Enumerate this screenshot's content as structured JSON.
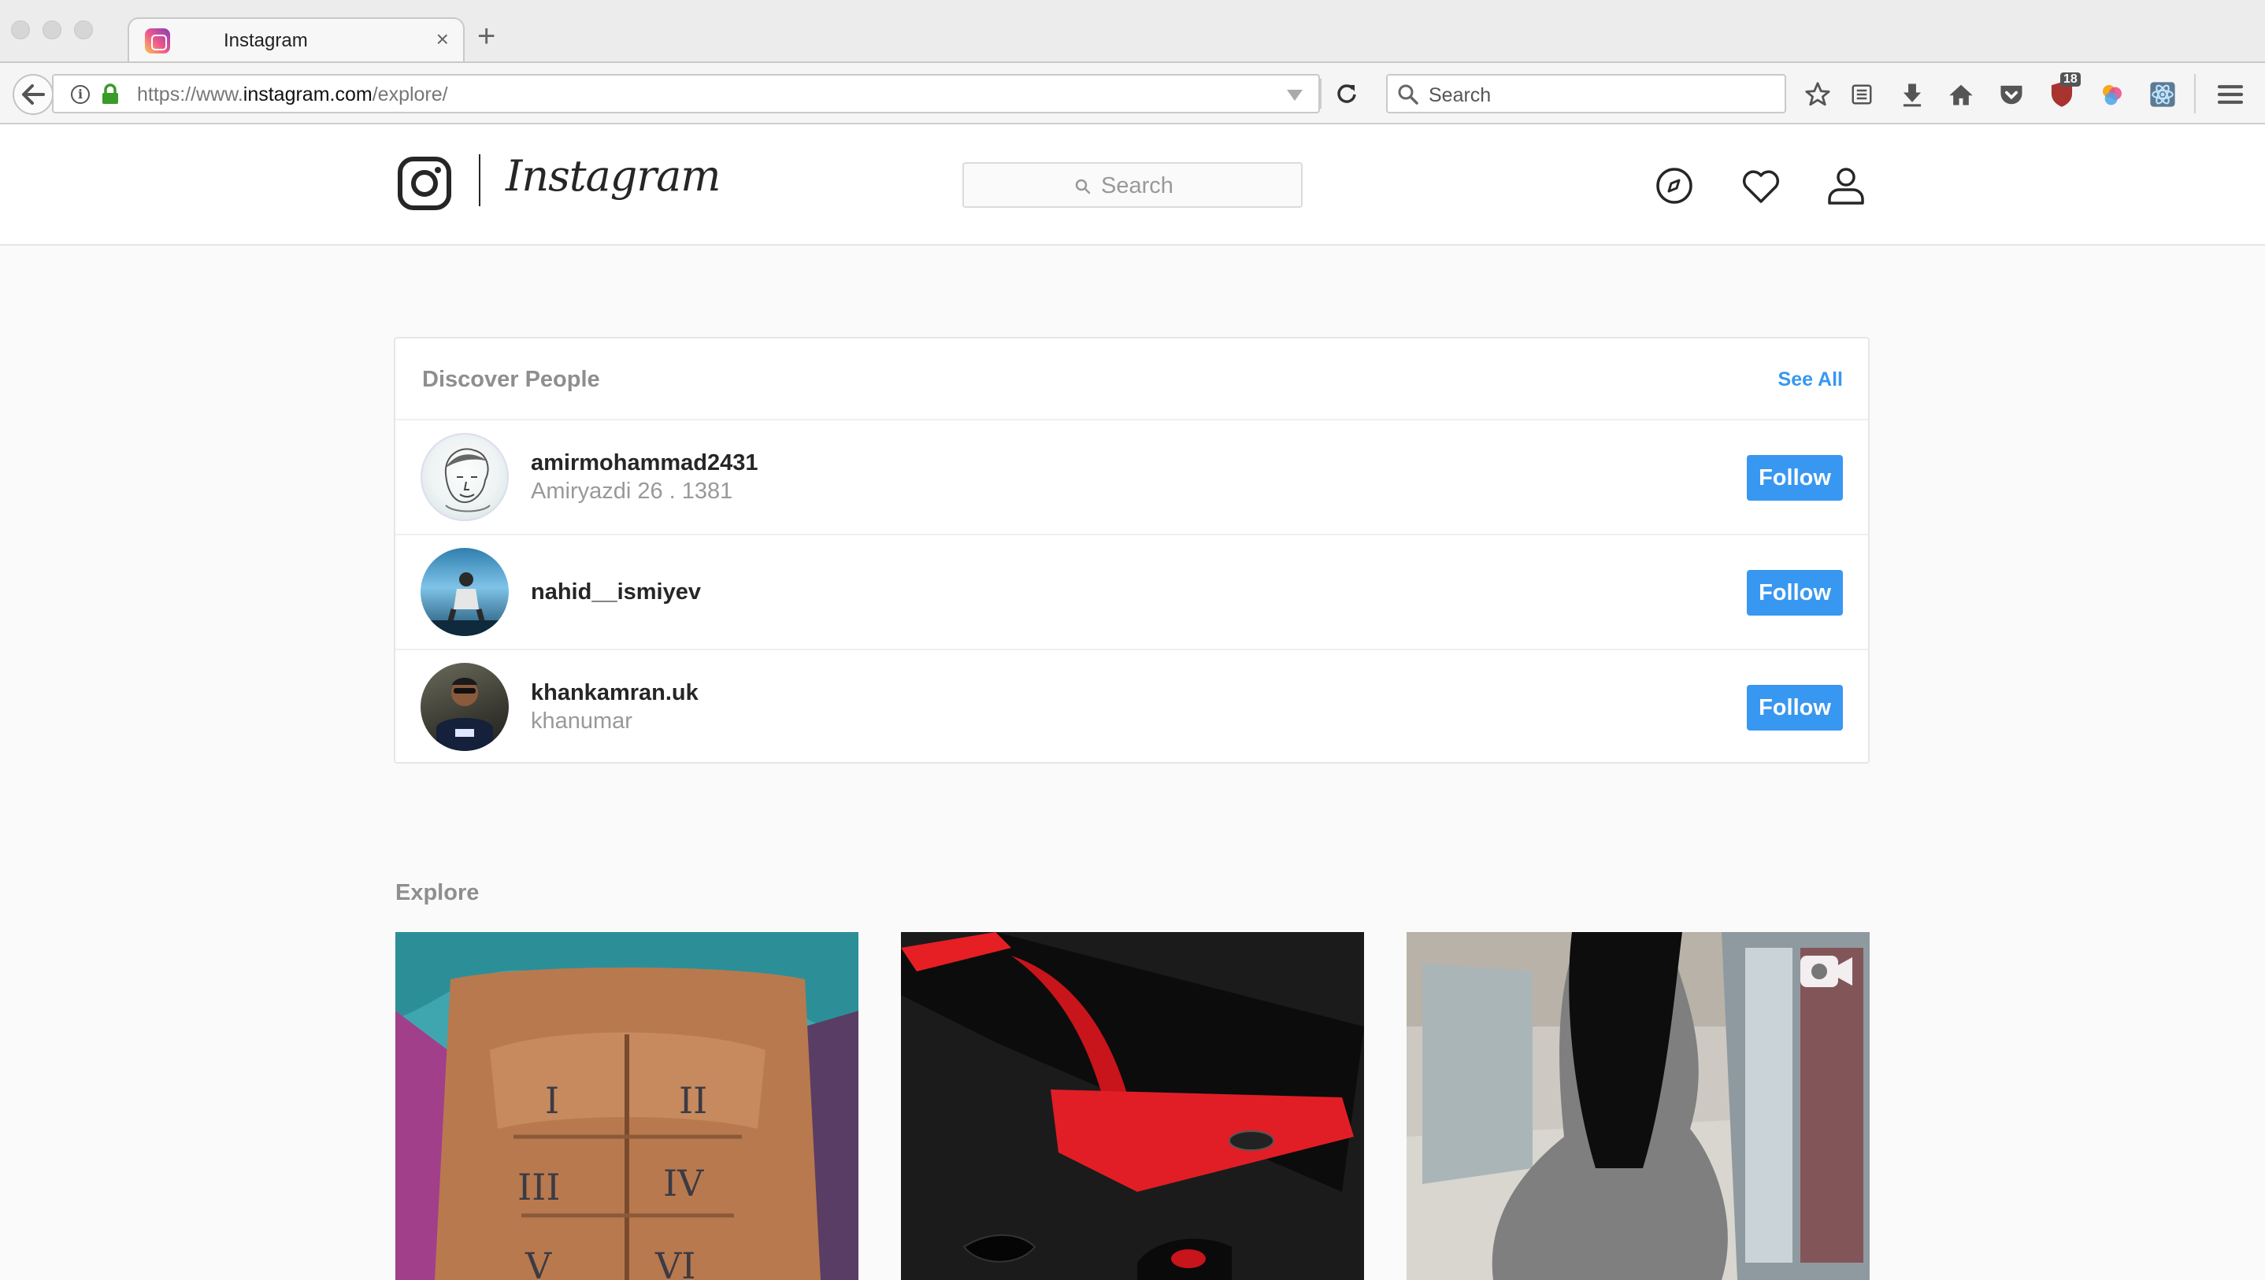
{
  "browser": {
    "tab_title": "Instagram",
    "tab_close": "×",
    "new_tab": "+",
    "url_prefix": "https://www.",
    "url_domain": "instagram.com",
    "url_path": "/explore/",
    "search_placeholder": "Search",
    "ublock_count": "18"
  },
  "header": {
    "wordmark": "Instagram",
    "search_placeholder": "Search"
  },
  "discover": {
    "title": "Discover People",
    "see_all": "See All",
    "people": [
      {
        "username": "amirmohammad2431",
        "subtitle": "Amiryazdi 26 . 1381",
        "follow": "Follow"
      },
      {
        "username": "nahid__ismiyev",
        "subtitle": "",
        "follow": "Follow"
      },
      {
        "username": "khankamran.uk",
        "subtitle": "khanumar",
        "follow": "Follow"
      }
    ]
  },
  "explore": {
    "title": "Explore",
    "tiles": [
      {
        "label": "I II III IV V VI"
      },
      {
        "label": ""
      },
      {
        "label": ""
      }
    ]
  }
}
